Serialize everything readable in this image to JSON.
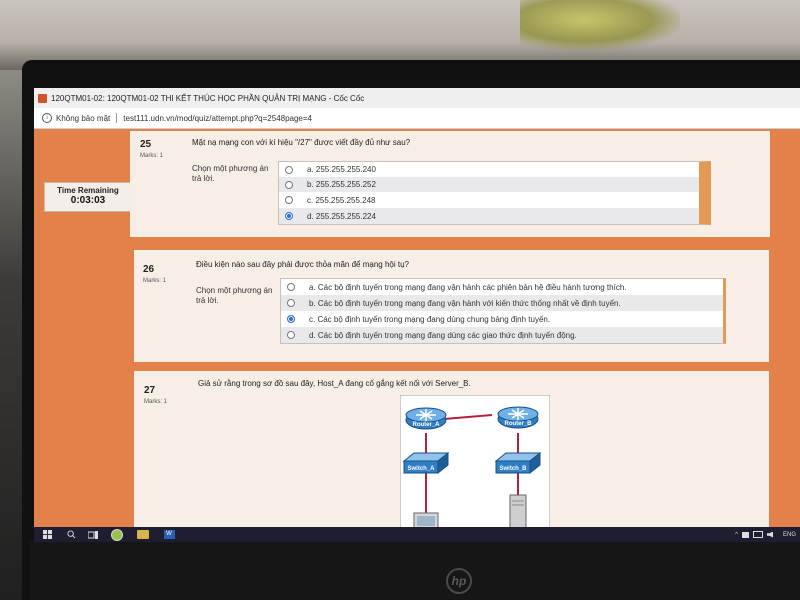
{
  "window": {
    "title": "120QTM01-02: 120QTM01-02 THI KẾT THÚC HỌC PHẦN QUẢN TRỊ MẠNG - Cốc Cốc",
    "security_label": "Không bảo mật",
    "url": "test111.udn.vn/mod/quiz/attempt.php?q=2548page=4"
  },
  "timer": {
    "label": "Time Remaining",
    "value": "0:03:03"
  },
  "questions": [
    {
      "number": "25",
      "marks": "Marks: 1",
      "text": "Mặt nạ mạng con với kí hiệu \"/27\" được viết đầy đủ như sau?",
      "prompt": "Chọn một phương án trả lời.",
      "options": [
        {
          "label": "a. 255.255.255.240",
          "selected": false
        },
        {
          "label": "b. 255.255.255.252",
          "selected": false
        },
        {
          "label": "c. 255.255.255.248",
          "selected": false
        },
        {
          "label": "d. 255.255.255.224",
          "selected": true
        }
      ]
    },
    {
      "number": "26",
      "marks": "Marks: 1",
      "text": "Điều kiện nào sau đây phải được thỏa mãn để mạng hội tụ?",
      "prompt": "Chọn một phương án trả lời.",
      "options": [
        {
          "label": "a. Các bộ định tuyến trong mạng đang vận hành các phiên bản hệ điều hành tương thích.",
          "selected": false
        },
        {
          "label": "b. Các bộ định tuyến trong mạng đang vận hành với kiến thức thống nhất về định tuyến.",
          "selected": false
        },
        {
          "label": "c. Các bộ định tuyến trong mạng đang dùng chung bảng định tuyến.",
          "selected": true
        },
        {
          "label": "d. Các bộ định tuyến trong mạng đang dùng các giao thức định tuyến động.",
          "selected": false
        }
      ]
    },
    {
      "number": "27",
      "marks": "Marks: 1",
      "text": "Giả sử rằng trong sơ đồ sau đây, Host_A đang cố gắng kết nối với Server_B.",
      "diagram": {
        "router_a": "Router_A",
        "router_b": "Router_B",
        "switch_a": "Switch_A",
        "switch_b": "Switch_B"
      }
    }
  ],
  "taskbar": {
    "lang": "ENG"
  },
  "colors": {
    "page_bg": "#e2824a",
    "card_bg": "#f7eee6",
    "accent": "#e49a57",
    "link_blue": "#1c5fa8",
    "selected_radio": "#2f6fd1"
  }
}
